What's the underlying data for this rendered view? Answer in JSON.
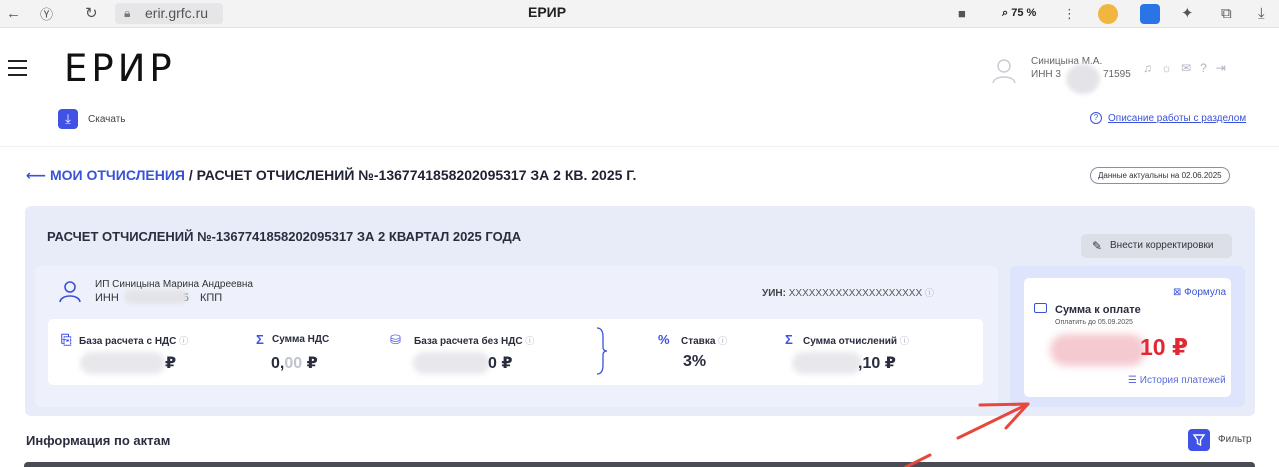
{
  "browser": {
    "url": "erir.grfc.ru",
    "title": "ЕРИР",
    "zoom": "75 %"
  },
  "app": {
    "logo": "ЕРИР",
    "user_name": "Синицына М.А.",
    "user_inn_prefix": "ИНН 3",
    "user_inn_suffix": "71595"
  },
  "toolbar": {
    "download_label": "Скачать",
    "help_link": "Описание работы с разделом"
  },
  "breadcrumb": {
    "back_label": "МОИ ОТЧИСЛЕНИЯ",
    "current": "/ РАСЧЕТ ОТЧИСЛЕНИЙ №-1367741858202095317 ЗА 2 КВ. 2025 Г.",
    "actual_badge": "Данные актуальны на 02.06.2025"
  },
  "calc": {
    "title": "РАСЧЕТ ОТЧИСЛЕНИЙ №-1367741858202095317 ЗА 2 КВАРТАЛ 2025 ГОДА",
    "edit_button": "Внести корректировки",
    "person_name": "ИП Синицына Марина Андреевна",
    "inn_label": "ИНН",
    "inn_tail": "5",
    "kpp_label": "КПП",
    "uin_label": "УИН:",
    "uin_value": "XXXXXXXXXXXXXXXXXXXX",
    "metrics": [
      {
        "label": "База расчета с НДС",
        "value": "₽"
      },
      {
        "label": "Сумма НДС",
        "value_main": "0,",
        "value_grey": "00",
        "currency": "₽"
      },
      {
        "label": "База расчета без НДС",
        "value": "0 ₽"
      },
      {
        "label": "Ставка",
        "value": "3%"
      },
      {
        "label": "Сумма отчислений",
        "value": ",10 ₽"
      }
    ]
  },
  "payment": {
    "title": "Сумма к оплате",
    "due": "Оплатить до 05.09.2025",
    "amount": "10 ₽",
    "formula_link": "Формула",
    "history_link": "История платежей"
  },
  "acts": {
    "title": "Информация по актам",
    "filter_label": "Фильтр"
  },
  "colors": {
    "accent": "#4052e6",
    "amount_red": "#e02935",
    "panel_bg": "#e8ecf9",
    "annotation_arrow": "#e8473c"
  }
}
